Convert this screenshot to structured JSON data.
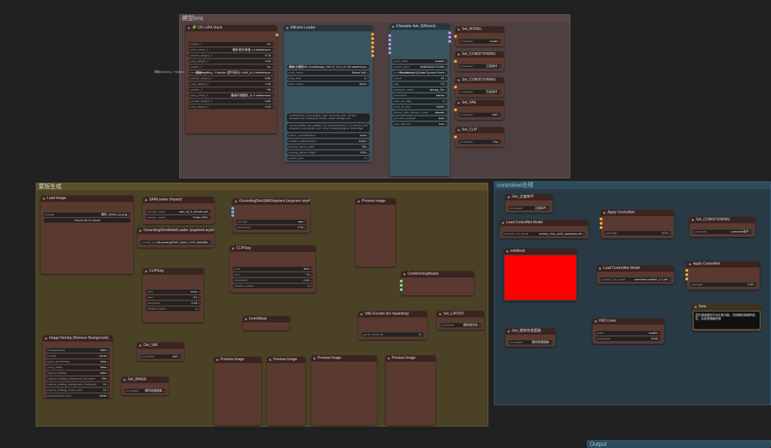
{
  "colors": {
    "group_lora": "#5a4444",
    "group_mask": "#5e5026",
    "group_cn": "#2d4b5d",
    "node": "#593930",
    "node_blue": "#3a5560"
  },
  "groups": {
    "lora": {
      "title": "模型lora"
    },
    "mask": {
      "title": "蒙版生成"
    },
    "controlnet": {
      "title": "controlnet处理"
    },
    "output": {
      "title": "Output"
    }
  },
  "lora_stack": {
    "title": "🧩 CR LoRA Stack",
    "fields": [
      {
        "name": "switch_1",
        "value": "On"
      },
      {
        "name": "lora_name_1",
        "value": "最新!超光感漫_v1.safetensors"
      },
      {
        "name": "model_weight_1",
        "value": "0.75"
      },
      {
        "name": "clip_weight_1",
        "value": "1.00"
      },
      {
        "name": "switch_2",
        "value": "On"
      },
      {
        "name": "lora_name_2",
        "value": "墨幽Anything - Flatcolor (超平画风) LoRA_v1.0.safetensors"
      },
      {
        "name": "model_weight_2",
        "value": "0.80"
      },
      {
        "name": "clip_weight_2",
        "value": "1.00"
      },
      {
        "name": "switch_3",
        "value": "Off"
      },
      {
        "name": "lora_name_3",
        "value": "墨幽纤细腰肢_v1.0.safetensors"
      },
      {
        "name": "model_weight_3",
        "value": "0.80"
      },
      {
        "name": "clip_weight_3",
        "value": "1.00"
      }
    ],
    "side_label": "墨幽Anything - Flatcolor (超平画风) LoRA_v1.0.safetensors"
  },
  "efficient_loader": {
    "title": "Efficient Loader",
    "fields": [
      {
        "name": "ckpt_name",
        "value": "最新!主模型SD-SouthBridge_SD1.5_V1.0_V1.05.safetensors"
      },
      {
        "name": "vae_name",
        "value": "Baked VAE"
      },
      {
        "name": "clip_skip",
        "value": "-2"
      },
      {
        "name": "lora_name",
        "value": "None"
      }
    ],
    "positive": "masterpiece, best quality, 1girl, full body, solo, simple background, looking at viewer, white background",
    "negative": "(worst quality, low quality:1.4), (monochrome:1.1), lowres, bad anatomy, bad hands, text, error, missing fingers, extra digit",
    "fields2": [
      {
        "name": "token_normalization",
        "value": "none"
      },
      {
        "name": "weight_interpretation",
        "value": "A1111"
      },
      {
        "name": "empty_latent_width",
        "value": "768"
      },
      {
        "name": "empty_latent_height",
        "value": "1024"
      },
      {
        "name": "batch_size",
        "value": "1"
      }
    ]
  },
  "ksampler": {
    "title": "KSampler Adv. (Efficient)",
    "fields": [
      {
        "name": "add_noise",
        "value": "enable"
      },
      {
        "name": "noise_seed",
        "value": "818836322712336"
      },
      {
        "name": "control_after_generate",
        "value": "Randomize / ◯ Last Queued Seed"
      },
      {
        "name": "steps",
        "value": "30"
      },
      {
        "name": "cfg",
        "value": "7.0"
      },
      {
        "name": "sampler_name",
        "value": "dpmpp_2m"
      },
      {
        "name": "scheduler",
        "value": "karras"
      },
      {
        "name": "start_at_step",
        "value": "0"
      },
      {
        "name": "end_at_step",
        "value": "10000"
      },
      {
        "name": "return_with_leftover_noise",
        "value": "disable"
      },
      {
        "name": "preview_method",
        "value": "auto"
      },
      {
        "name": "vae_decode",
        "value": "true"
      }
    ]
  },
  "setters": [
    {
      "title": "Set_MODEL",
      "label": "Constant",
      "value": "model"
    },
    {
      "title": "Set_CONDITIONING",
      "label": "Constant",
      "value": "正面条件"
    },
    {
      "title": "Set_CONDITIONING",
      "label": "Constant",
      "value": "负面条件"
    },
    {
      "title": "Set_VAE",
      "label": "Constant",
      "value": "VAE"
    },
    {
      "title": "Set_CLIP",
      "label": "Constant",
      "value": "Clip"
    }
  ],
  "mask_nodes": {
    "load_image": {
      "title": "Load Image",
      "image_label": "image",
      "image_value": "模特_00004_(2).png",
      "upload": "choose file to upload"
    },
    "sam_loader": {
      "title": "SAMLoader (Impact)",
      "fields": [
        {
          "name": "model_name",
          "value": "sam_vit_b_01ec64.pth"
        },
        {
          "name": "device_mode",
          "value": "Prefer GPU"
        }
      ]
    },
    "dino_loader": {
      "title": "GroundingDinoModelLoader (segment anything)",
      "fields": [
        {
          "name": "model_name",
          "value": "GroundingDINO_SwinT_OGC (694MB)"
        }
      ]
    },
    "dino_sam": {
      "title": "GroundingDinoSAMSegment (segment anything)",
      "fields": [
        {
          "name": "prompt",
          "value": "face"
        },
        {
          "name": "threshold",
          "value": "0.30"
        }
      ]
    },
    "preview1": {
      "title": "Preview Image"
    },
    "clipseg1": {
      "title": "CLIPSeg",
      "fields": [
        {
          "name": "text",
          "value": "face"
        },
        {
          "name": "blur",
          "value": "7.6"
        },
        {
          "name": "threshold",
          "value": "0.40"
        },
        {
          "name": "dilation_factor",
          "value": "4"
        }
      ]
    },
    "clipseg2": {
      "title": "CLIPSeg",
      "fields": [
        {
          "name": "text",
          "value": "none"
        },
        {
          "name": "blur",
          "value": "3.0"
        },
        {
          "name": "threshold",
          "value": "0.30"
        },
        {
          "name": "dilation_factor",
          "value": "4"
        }
      ]
    },
    "combine": {
      "title": "CombineSegMasks"
    },
    "invert": {
      "title": "InvertMask"
    },
    "vae_encode": {
      "title": "VAE Encode (for Inpainting)",
      "fields": [
        {
          "name": "grow_mask_by",
          "value": "6"
        }
      ]
    },
    "set_latent": {
      "title": "Set_LATENT",
      "label": "Constant",
      "value": "模特潜空间"
    },
    "rembg": {
      "title": "Image Rembg (Remove Background)",
      "fields": [
        {
          "name": "transparency",
          "value": "false"
        },
        {
          "name": "model",
          "value": "u2net"
        },
        {
          "name": "post_processing",
          "value": "false"
        },
        {
          "name": "only_mask",
          "value": "false"
        },
        {
          "name": "alpha_matting",
          "value": "false"
        },
        {
          "name": "alpha_matting_foreground_threshold",
          "value": "240"
        },
        {
          "name": "alpha_matting_background_threshold",
          "value": "10"
        },
        {
          "name": "alpha_matting_erode_size",
          "value": "10"
        },
        {
          "name": "background_color",
          "value": "white"
        }
      ]
    },
    "get_vae": {
      "title": "Get_VAE",
      "label": "Constant",
      "value": "VAE"
    },
    "set_image": {
      "title": "Set_IMAGE",
      "label": "Constant",
      "value": "模特背景图像"
    },
    "previews": [
      "Preview Image",
      "Preview Image",
      "Preview Image",
      "Preview Image"
    ]
  },
  "cn_nodes": {
    "get_pos": {
      "title": "Get_正面条件",
      "label": "Constant",
      "value": "正面条件"
    },
    "load_cn1": {
      "title": "Load ControlNet Model",
      "fields": [
        {
          "name": "control_net_name",
          "value": "control_v11p_sd15_openpose.pth"
        }
      ]
    },
    "apply1": {
      "title": "Apply ControlNet",
      "fields": [
        {
          "name": "strength",
          "value": "0.70"
        }
      ]
    },
    "set_cond": {
      "title": "Set_CONDITIONING",
      "label": "Constant",
      "value": "controlnet条件"
    },
    "solid": {
      "title": "solidfood",
      "color": "#ff0000"
    },
    "load_cn2": {
      "title": "Load ControlNet Model",
      "fields": [
        {
          "name": "control_net_name",
          "value": "controlnet-scribble_1.1.pth"
        }
      ]
    },
    "apply2": {
      "title": "Apply ControlNet",
      "fields": [
        {
          "name": "strength",
          "value": "0.50"
        }
      ]
    },
    "note": {
      "title": "Note",
      "text": "蓝色通道模型开启反推功能，用线稿控制模特造型，实现更精确控制"
    },
    "get_img": {
      "title": "Get_模特背景图像",
      "label": "Constant",
      "value": "模特背景图像"
    },
    "hed": {
      "title": "HED Lines",
      "fields": [
        {
          "name": "safe",
          "value": "enable"
        },
        {
          "name": "resolution",
          "value": "2048"
        }
      ]
    }
  }
}
